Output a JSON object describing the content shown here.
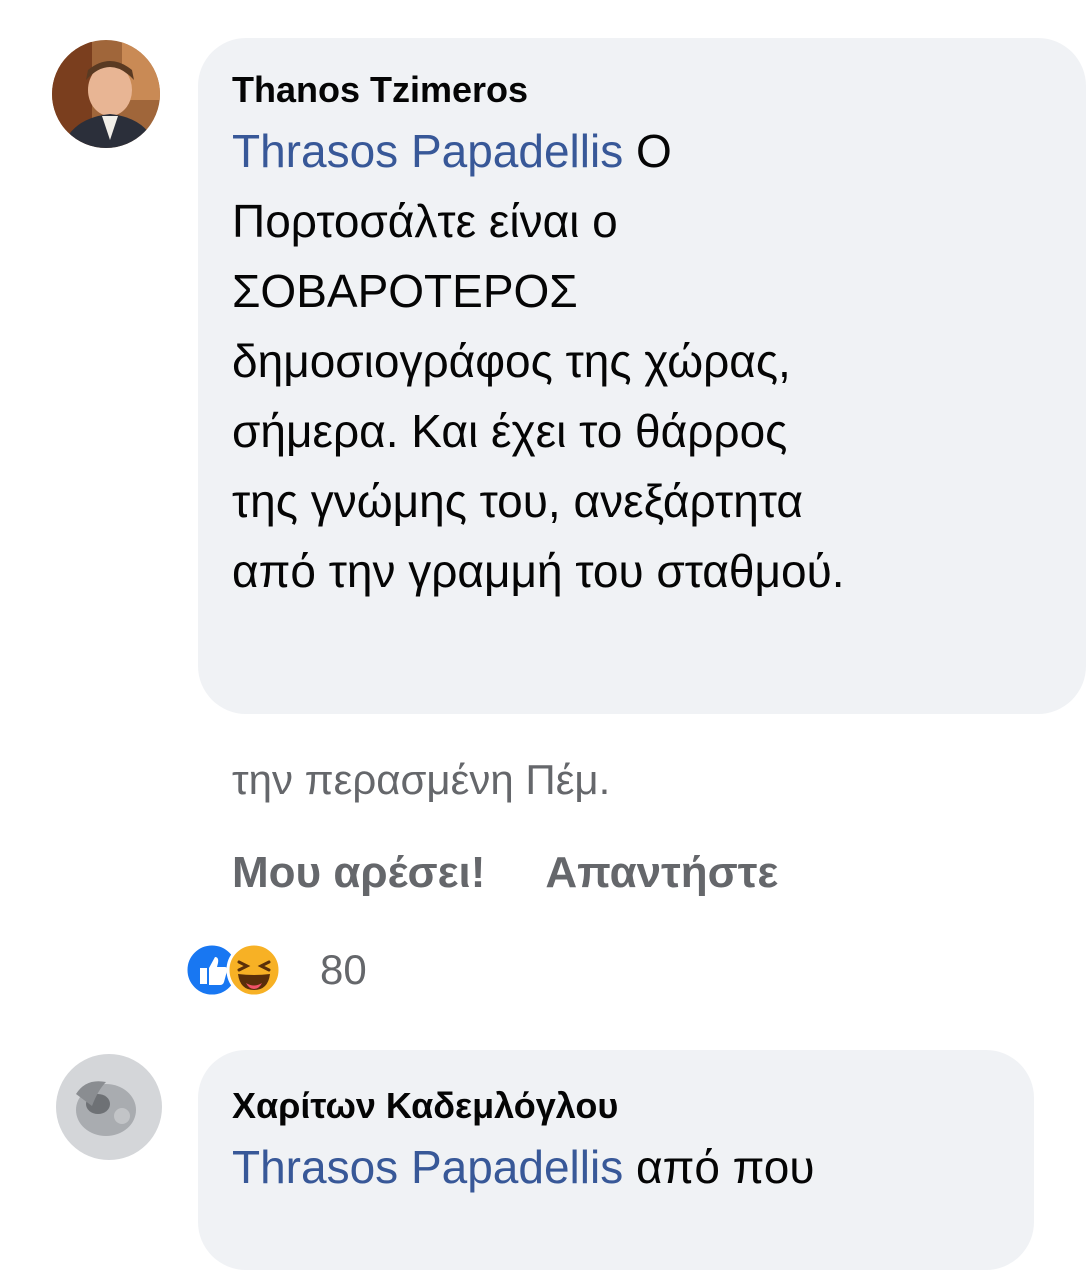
{
  "comment1": {
    "author": "Thanos Tzimeros",
    "mention": "Thrasos Papadellis",
    "lines": [
      "Ο",
      "Πορτοσάλτε είναι ο",
      "ΣΟΒΑΡΟΤΕΡΟΣ",
      "δημοσιογράφος της χώρας,",
      "σήμερα. Και έχει το θάρρος",
      "της γνώμης του, ανεξάρτητα",
      "από την γραμμή του σταθμού."
    ],
    "timestamp": "την περασμένη Πέμ.",
    "like_label": "Μου αρέσει!",
    "reply_label": "Απαντήστε",
    "reaction_count": "80",
    "reactions": [
      "like-icon",
      "haha-icon"
    ]
  },
  "comment2": {
    "author": "Χαρίτων Καδεμλόγλου",
    "mention": "Thrasos Papadellis",
    "text": "από που"
  },
  "colors": {
    "bubble": "#f0f2f5",
    "mention": "#385898",
    "meta": "#65676b",
    "like_blue": "#1877f2",
    "haha_yellow": "#f7b125"
  }
}
